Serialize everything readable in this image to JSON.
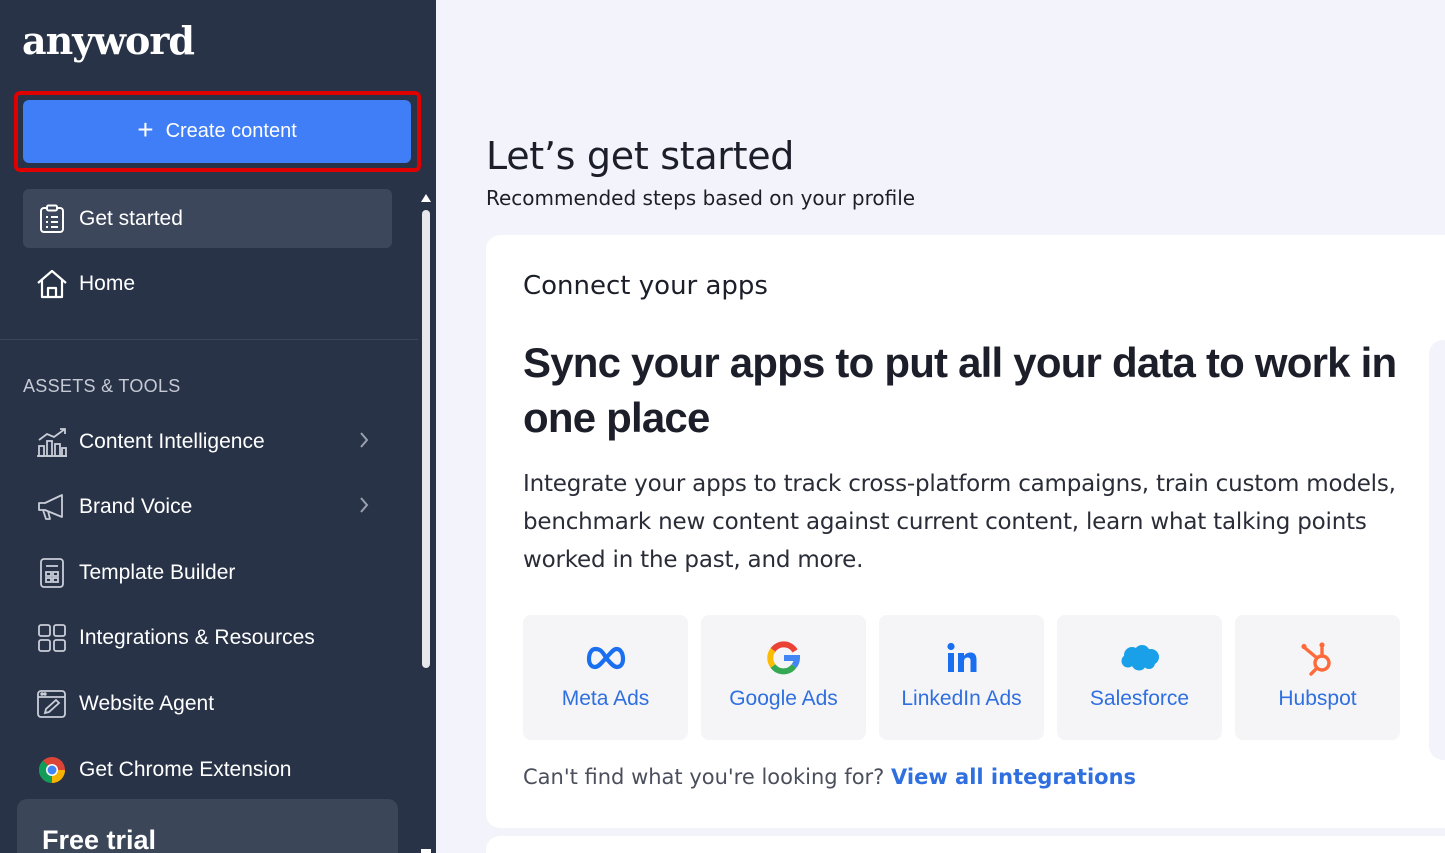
{
  "sidebar": {
    "logo": "anyword",
    "create_label": "Create content",
    "top_items": [
      {
        "label": "Get started",
        "icon": "clipboard-list-icon",
        "active": true
      },
      {
        "label": "Home",
        "icon": "home-icon",
        "active": false
      }
    ],
    "section_label": "ASSETS & TOOLS",
    "tools": [
      {
        "label": "Content Intelligence",
        "icon": "chart-icon",
        "has_chevron": true
      },
      {
        "label": "Brand Voice",
        "icon": "megaphone-icon",
        "has_chevron": true
      },
      {
        "label": "Template Builder",
        "icon": "template-icon",
        "has_chevron": false
      },
      {
        "label": "Integrations & Resources",
        "icon": "grid-icon",
        "has_chevron": false
      },
      {
        "label": "Website Agent",
        "icon": "browser-edit-icon",
        "has_chevron": false
      },
      {
        "label": "Get Chrome Extension",
        "icon": "chrome-icon",
        "has_chevron": false
      }
    ],
    "trial_title": "Free trial"
  },
  "main": {
    "title": "Let’s get started",
    "subtitle": "Recommended steps based on your profile",
    "card": {
      "kicker": "Connect your apps",
      "heading": "Sync your apps to put all your data to work in one place",
      "description": "Integrate your apps to track cross-platform campaigns, train custom models, benchmark new content against current content, learn what talking points worked in the past, and more.",
      "apps": [
        {
          "name": "Meta Ads",
          "icon": "meta-icon"
        },
        {
          "name": "Google Ads",
          "icon": "google-icon"
        },
        {
          "name": "LinkedIn Ads",
          "icon": "linkedin-icon"
        },
        {
          "name": "Salesforce",
          "icon": "salesforce-icon"
        },
        {
          "name": "Hubspot",
          "icon": "hubspot-icon"
        }
      ],
      "cant_find": "Can't find what you're looking for?",
      "view_all": "View all integrations"
    }
  },
  "colors": {
    "sidebar_bg": "#283347",
    "accent": "#3f7ef7",
    "link": "#2f6fe0",
    "highlight": "#e00000",
    "page_bg": "#f3f4fb"
  }
}
